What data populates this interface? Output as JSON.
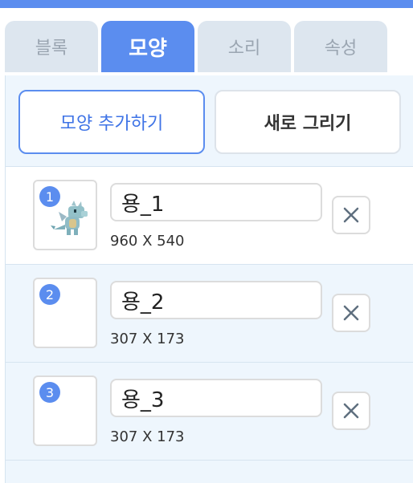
{
  "tabs": {
    "block": "블록",
    "costume": "모양",
    "sound": "소리",
    "properties": "속성"
  },
  "actions": {
    "add_costume": "모양 추가하기",
    "draw_new": "새로 그리기"
  },
  "costumes": [
    {
      "number": "1",
      "name": "용_1",
      "size": "960 X 540",
      "selected": true,
      "thumbnail": "dragon-icon"
    },
    {
      "number": "2",
      "name": "용_2",
      "size": "307 X 173",
      "selected": false,
      "thumbnail": ""
    },
    {
      "number": "3",
      "name": "용_3",
      "size": "307 X 173",
      "selected": false,
      "thumbnail": ""
    }
  ],
  "colors": {
    "accent": "#5b8def",
    "panel_bg": "#eef6fd",
    "tab_inactive": "#dde6ef"
  },
  "icons": {
    "delete": "close-icon"
  }
}
